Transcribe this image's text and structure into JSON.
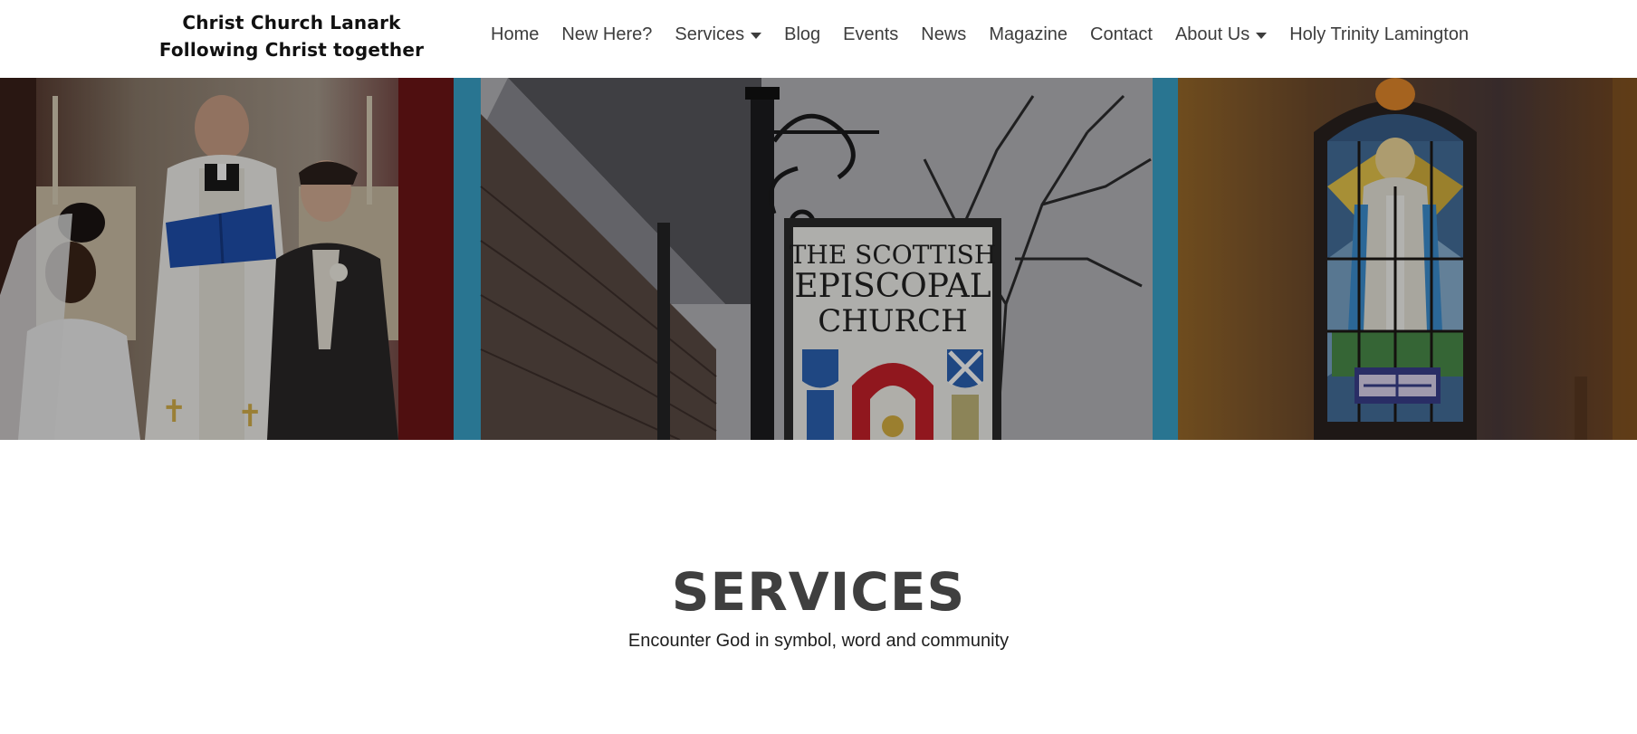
{
  "site": {
    "title_line1": "Christ Church Lanark",
    "title_line2": "Following Christ together"
  },
  "nav": {
    "items": [
      {
        "label": "Home",
        "dropdown": false
      },
      {
        "label": "New Here?",
        "dropdown": false
      },
      {
        "label": "Services",
        "dropdown": true
      },
      {
        "label": "Blog",
        "dropdown": false
      },
      {
        "label": "Events",
        "dropdown": false
      },
      {
        "label": "News",
        "dropdown": false
      },
      {
        "label": "Magazine",
        "dropdown": false
      },
      {
        "label": "Contact",
        "dropdown": false
      },
      {
        "label": "About Us",
        "dropdown": true
      },
      {
        "label": "Holy Trinity Lamington",
        "dropdown": false
      }
    ]
  },
  "hero": {
    "sign_line1": "THE SCOTTISH",
    "sign_line2": "EPISCOPAL",
    "sign_line3": "CHURCH",
    "images": [
      "wedding-ceremony-photo",
      "church-sign-photo",
      "stained-glass-window-photo"
    ]
  },
  "section": {
    "title": "SERVICES",
    "subtitle": "Encounter God in symbol, word and community"
  },
  "colors": {
    "nav_text": "#3d3d3d",
    "heading": "#3f3f3f",
    "sign_accent_blue": "#3aa3c9",
    "sign_shield_red": "#c8202a"
  }
}
